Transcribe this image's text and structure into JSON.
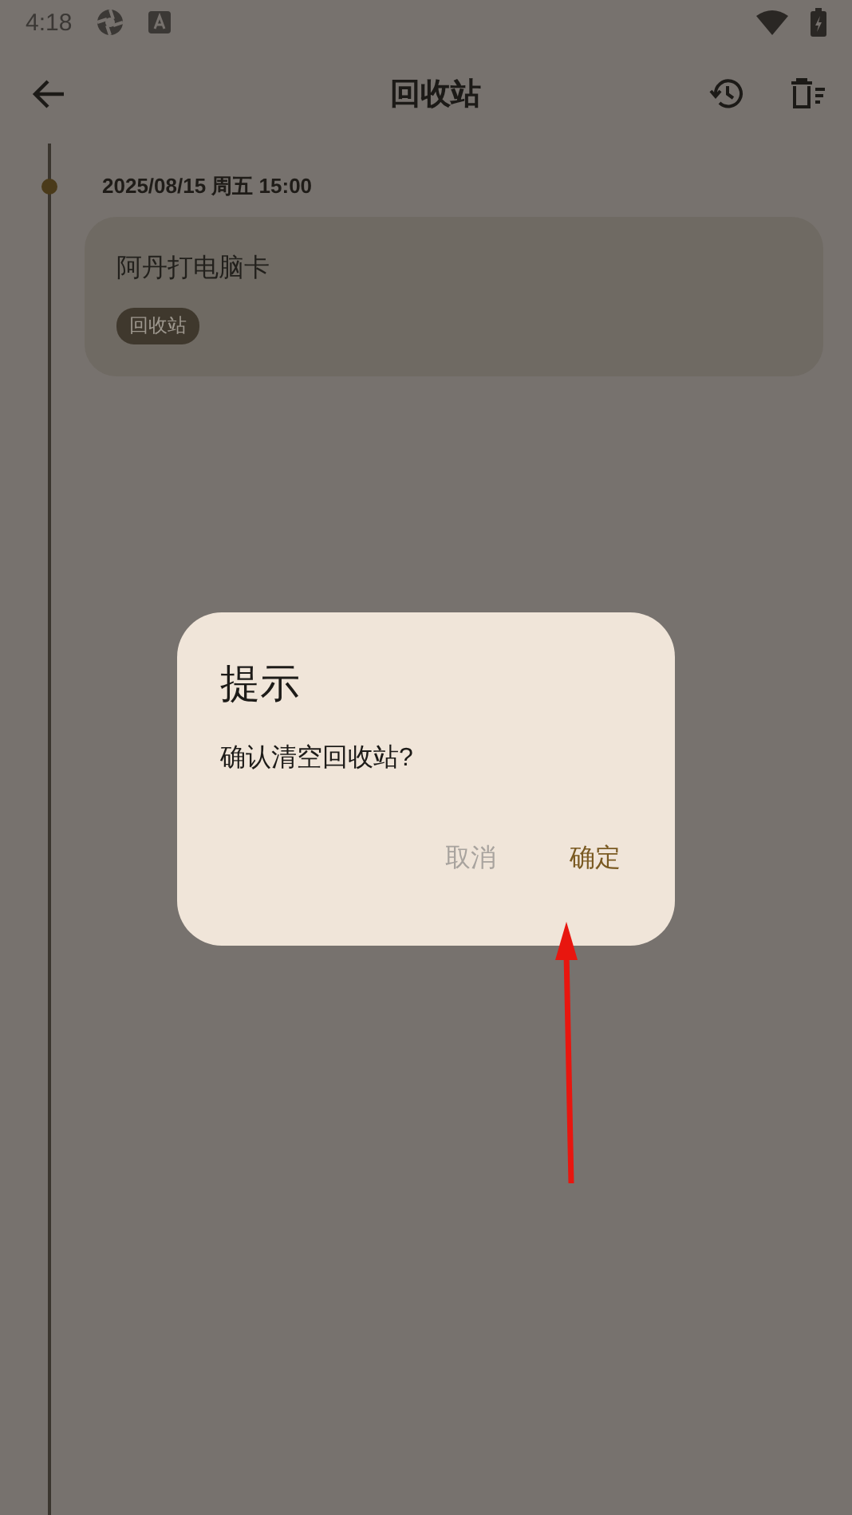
{
  "status_bar": {
    "time": "4:18"
  },
  "toolbar": {
    "title": "回收站"
  },
  "timeline": [
    {
      "date": "2025/08/15 周五 15:00",
      "notes": [
        {
          "title": "阿丹打电脑卡",
          "tag": "回收站"
        }
      ]
    }
  ],
  "dialog": {
    "title": "提示",
    "message": "确认清空回收站?",
    "buttons": [
      {
        "label": "取消",
        "kind": "cancel"
      },
      {
        "label": "确定",
        "kind": "confirm"
      }
    ]
  },
  "annotation": {
    "kind": "arrow"
  }
}
